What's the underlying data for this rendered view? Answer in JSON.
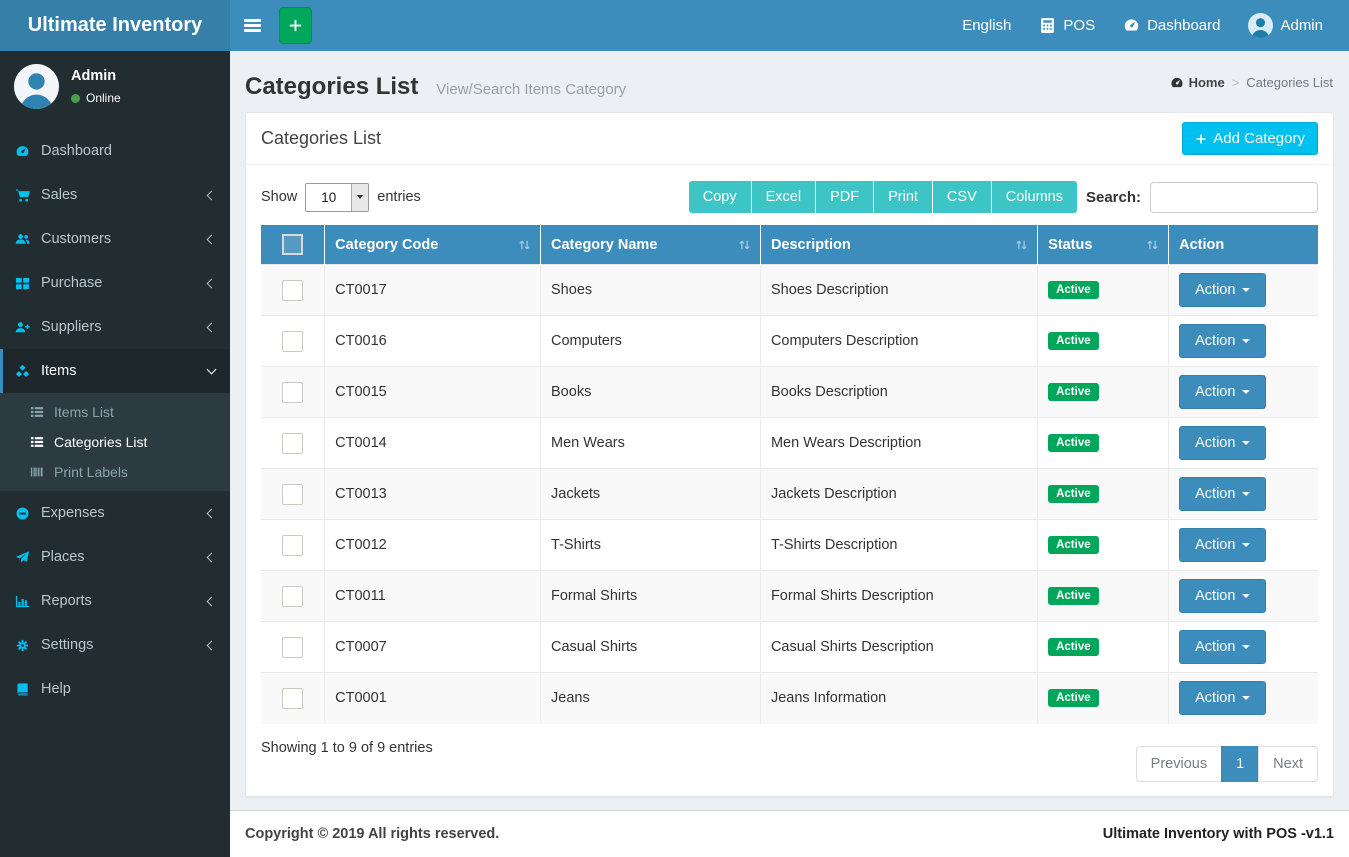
{
  "brand": {
    "title": "Ultimate Inventory"
  },
  "navbar": {
    "language": "English",
    "pos": "POS",
    "dashboard": "Dashboard",
    "user": "Admin"
  },
  "sidebar": {
    "user": {
      "name": "Admin",
      "status": "Online"
    },
    "menu": [
      {
        "label": "Dashboard",
        "icon": "dashboard"
      },
      {
        "label": "Sales",
        "icon": "cart",
        "chevron": "left"
      },
      {
        "label": "Customers",
        "icon": "users",
        "chevron": "left"
      },
      {
        "label": "Purchase",
        "icon": "grid",
        "chevron": "left"
      },
      {
        "label": "Suppliers",
        "icon": "user-plus",
        "chevron": "left"
      },
      {
        "label": "Items",
        "icon": "cubes",
        "chevron": "down",
        "active": true,
        "submenu": [
          {
            "label": "Items List",
            "icon": "list",
            "active": false
          },
          {
            "label": "Categories List",
            "icon": "list",
            "active": true
          },
          {
            "label": "Print Labels",
            "icon": "barcode",
            "active": false
          }
        ]
      },
      {
        "label": "Expenses",
        "icon": "minus-circle",
        "chevron": "left"
      },
      {
        "label": "Places",
        "icon": "send",
        "chevron": "left"
      },
      {
        "label": "Reports",
        "icon": "bar-chart",
        "chevron": "left"
      },
      {
        "label": "Settings",
        "icon": "gears",
        "chevron": "left"
      },
      {
        "label": "Help",
        "icon": "book"
      }
    ]
  },
  "page": {
    "title": "Categories List",
    "subtitle": "View/Search Items Category",
    "breadcrumb": {
      "home": "Home",
      "separator": ">",
      "current": "Categories List"
    }
  },
  "panel": {
    "heading": "Categories List",
    "add_button_label": "Add Category"
  },
  "controls": {
    "show_label": "Show",
    "entries_label": "entries",
    "page_size": "10",
    "export_buttons": [
      "Copy",
      "Excel",
      "PDF",
      "Print",
      "CSV",
      "Columns"
    ],
    "search_label": "Search:",
    "search_value": ""
  },
  "table": {
    "columns": [
      {
        "label": "Category Code",
        "sortable": true
      },
      {
        "label": "Category Name",
        "sortable": true
      },
      {
        "label": "Description",
        "sortable": true
      },
      {
        "label": "Status",
        "sortable": true
      },
      {
        "label": "Action",
        "sortable": false
      }
    ],
    "rows": [
      {
        "code": "CT0017",
        "name": "Shoes",
        "description": "Shoes Description",
        "status": "Active",
        "action_label": "Action"
      },
      {
        "code": "CT0016",
        "name": "Computers",
        "description": "Computers Description",
        "status": "Active",
        "action_label": "Action"
      },
      {
        "code": "CT0015",
        "name": "Books",
        "description": "Books Description",
        "status": "Active",
        "action_label": "Action"
      },
      {
        "code": "CT0014",
        "name": "Men Wears",
        "description": "Men Wears Description",
        "status": "Active",
        "action_label": "Action"
      },
      {
        "code": "CT0013",
        "name": "Jackets",
        "description": "Jackets Description",
        "status": "Active",
        "action_label": "Action"
      },
      {
        "code": "CT0012",
        "name": "T-Shirts",
        "description": "T-Shirts Description",
        "status": "Active",
        "action_label": "Action"
      },
      {
        "code": "CT0011",
        "name": "Formal Shirts",
        "description": "Formal Shirts Description",
        "status": "Active",
        "action_label": "Action"
      },
      {
        "code": "CT0007",
        "name": "Casual Shirts",
        "description": "Casual Shirts Description",
        "status": "Active",
        "action_label": "Action"
      },
      {
        "code": "CT0001",
        "name": "Jeans",
        "description": "Jeans Information",
        "status": "Active",
        "action_label": "Action"
      }
    ],
    "info": "Showing 1 to 9 of 9 entries"
  },
  "pagination": {
    "previous": "Previous",
    "page": "1",
    "next": "Next"
  },
  "footer": {
    "left": "Copyright © 2019 All rights reserved.",
    "right": "Ultimate Inventory with POS -v1.1"
  },
  "colors": {
    "navbar": "#3c8dbc",
    "logo_bg": "#367fa9",
    "sidebar_bg": "#222d32",
    "submenu_bg": "#2c3b41",
    "accent_aqua": "#00c0ef",
    "green": "#00a65a",
    "export_teal": "#3dc5c6",
    "table_header": "#3c8dbc",
    "badge_active": "#00a65a",
    "body_bg": "#ecf0f5"
  }
}
